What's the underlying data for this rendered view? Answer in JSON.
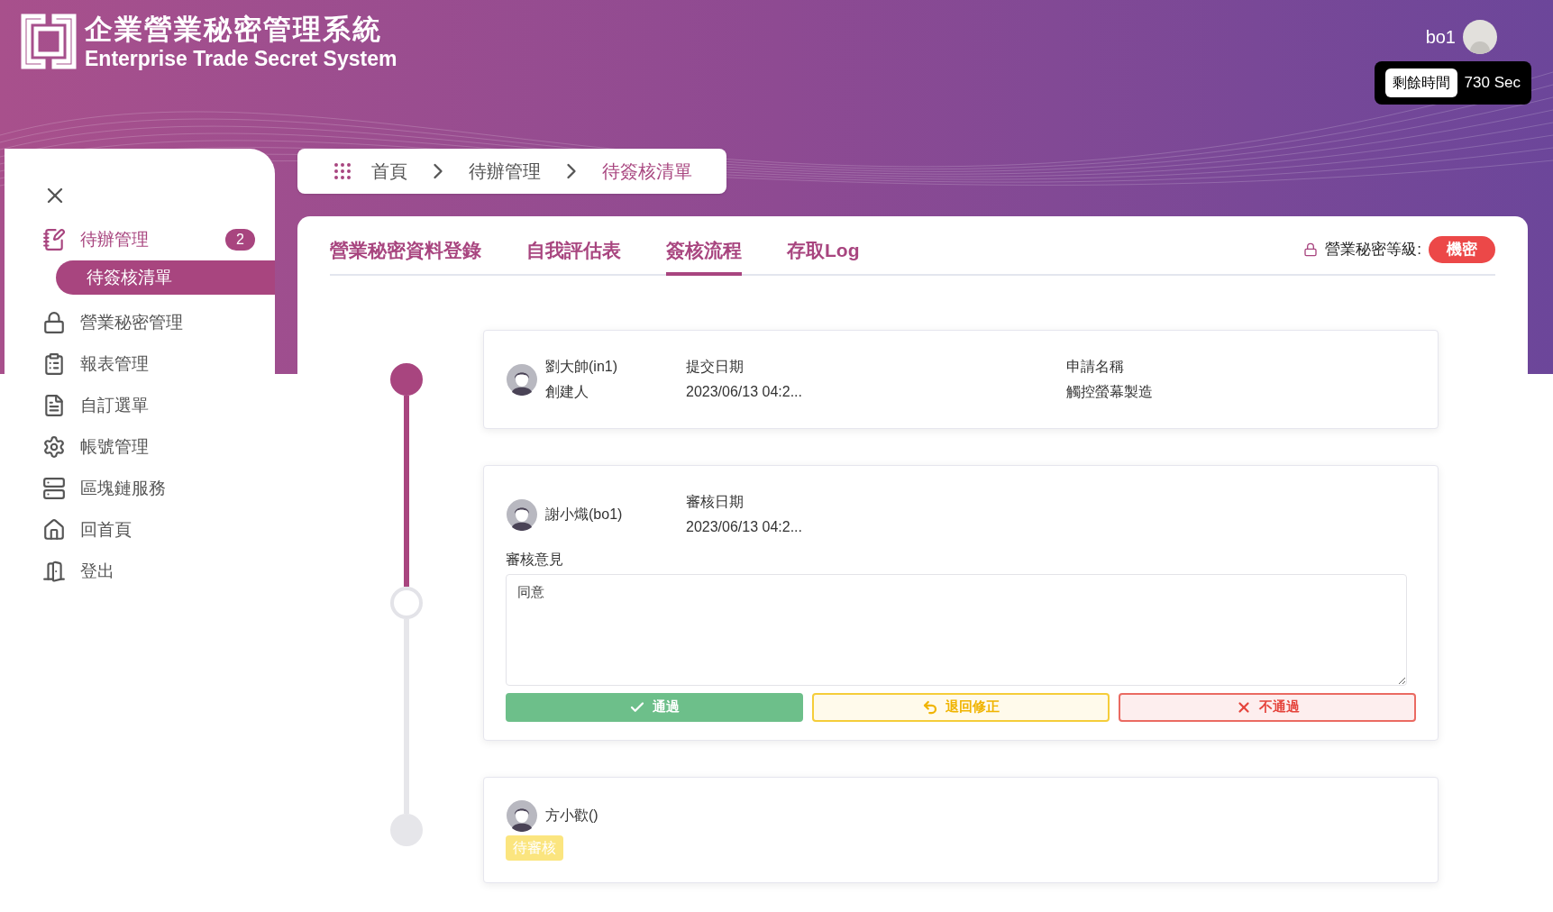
{
  "header": {
    "title": "企業營業秘密管理系統",
    "subtitle": "Enterprise Trade Secret System",
    "user": "bo1",
    "timer": {
      "label": "剩餘時間",
      "value": "730 Sec"
    }
  },
  "sidebar": {
    "items": [
      {
        "label": "待辦管理",
        "badge": "2",
        "selected": true,
        "expanded": true,
        "children": [
          {
            "label": "待簽核清單",
            "selected": true
          }
        ]
      },
      {
        "label": "營業秘密管理",
        "selected": false
      },
      {
        "label": "報表管理",
        "selected": false
      },
      {
        "label": "自訂選單",
        "selected": false
      },
      {
        "label": "帳號管理",
        "selected": false
      },
      {
        "label": "區塊鏈服務",
        "selected": false
      },
      {
        "label": "回首頁",
        "selected": false
      },
      {
        "label": "登出",
        "selected": false
      }
    ]
  },
  "breadcrumb": [
    {
      "label": "首頁",
      "current": false
    },
    {
      "label": "待辦管理",
      "current": false
    },
    {
      "label": "待簽核清單",
      "current": true
    }
  ],
  "tabs": [
    {
      "label": "營業秘密資料登錄",
      "selected": false
    },
    {
      "label": "自我評估表",
      "selected": false
    },
    {
      "label": "簽核流程",
      "selected": true
    },
    {
      "label": "存取Log",
      "selected": false
    }
  ],
  "security": {
    "label": "營業秘密等級:",
    "level": "機密"
  },
  "timeline": [
    {
      "kind": "creator",
      "completed": true,
      "current": false,
      "name": "劉大帥(in1)",
      "role": "創建人",
      "date_label": "提交日期",
      "date": "2023/06/13 04:2...",
      "title_label": "申請名稱",
      "title": "觸控螢幕製造"
    },
    {
      "kind": "review",
      "completed": false,
      "current": true,
      "name": "謝小熾(bo1)",
      "date_label": "審核日期",
      "date": "2023/06/13 04:2...",
      "comment_label": "審核意見",
      "comment": "同意",
      "actions": [
        {
          "kind": "approve",
          "label": "通過"
        },
        {
          "kind": "return",
          "label": "退回修正"
        },
        {
          "kind": "reject",
          "label": "不通過"
        }
      ]
    },
    {
      "kind": "pending",
      "completed": false,
      "current": false,
      "name": "方小歡()",
      "badge": "待審核"
    }
  ]
}
